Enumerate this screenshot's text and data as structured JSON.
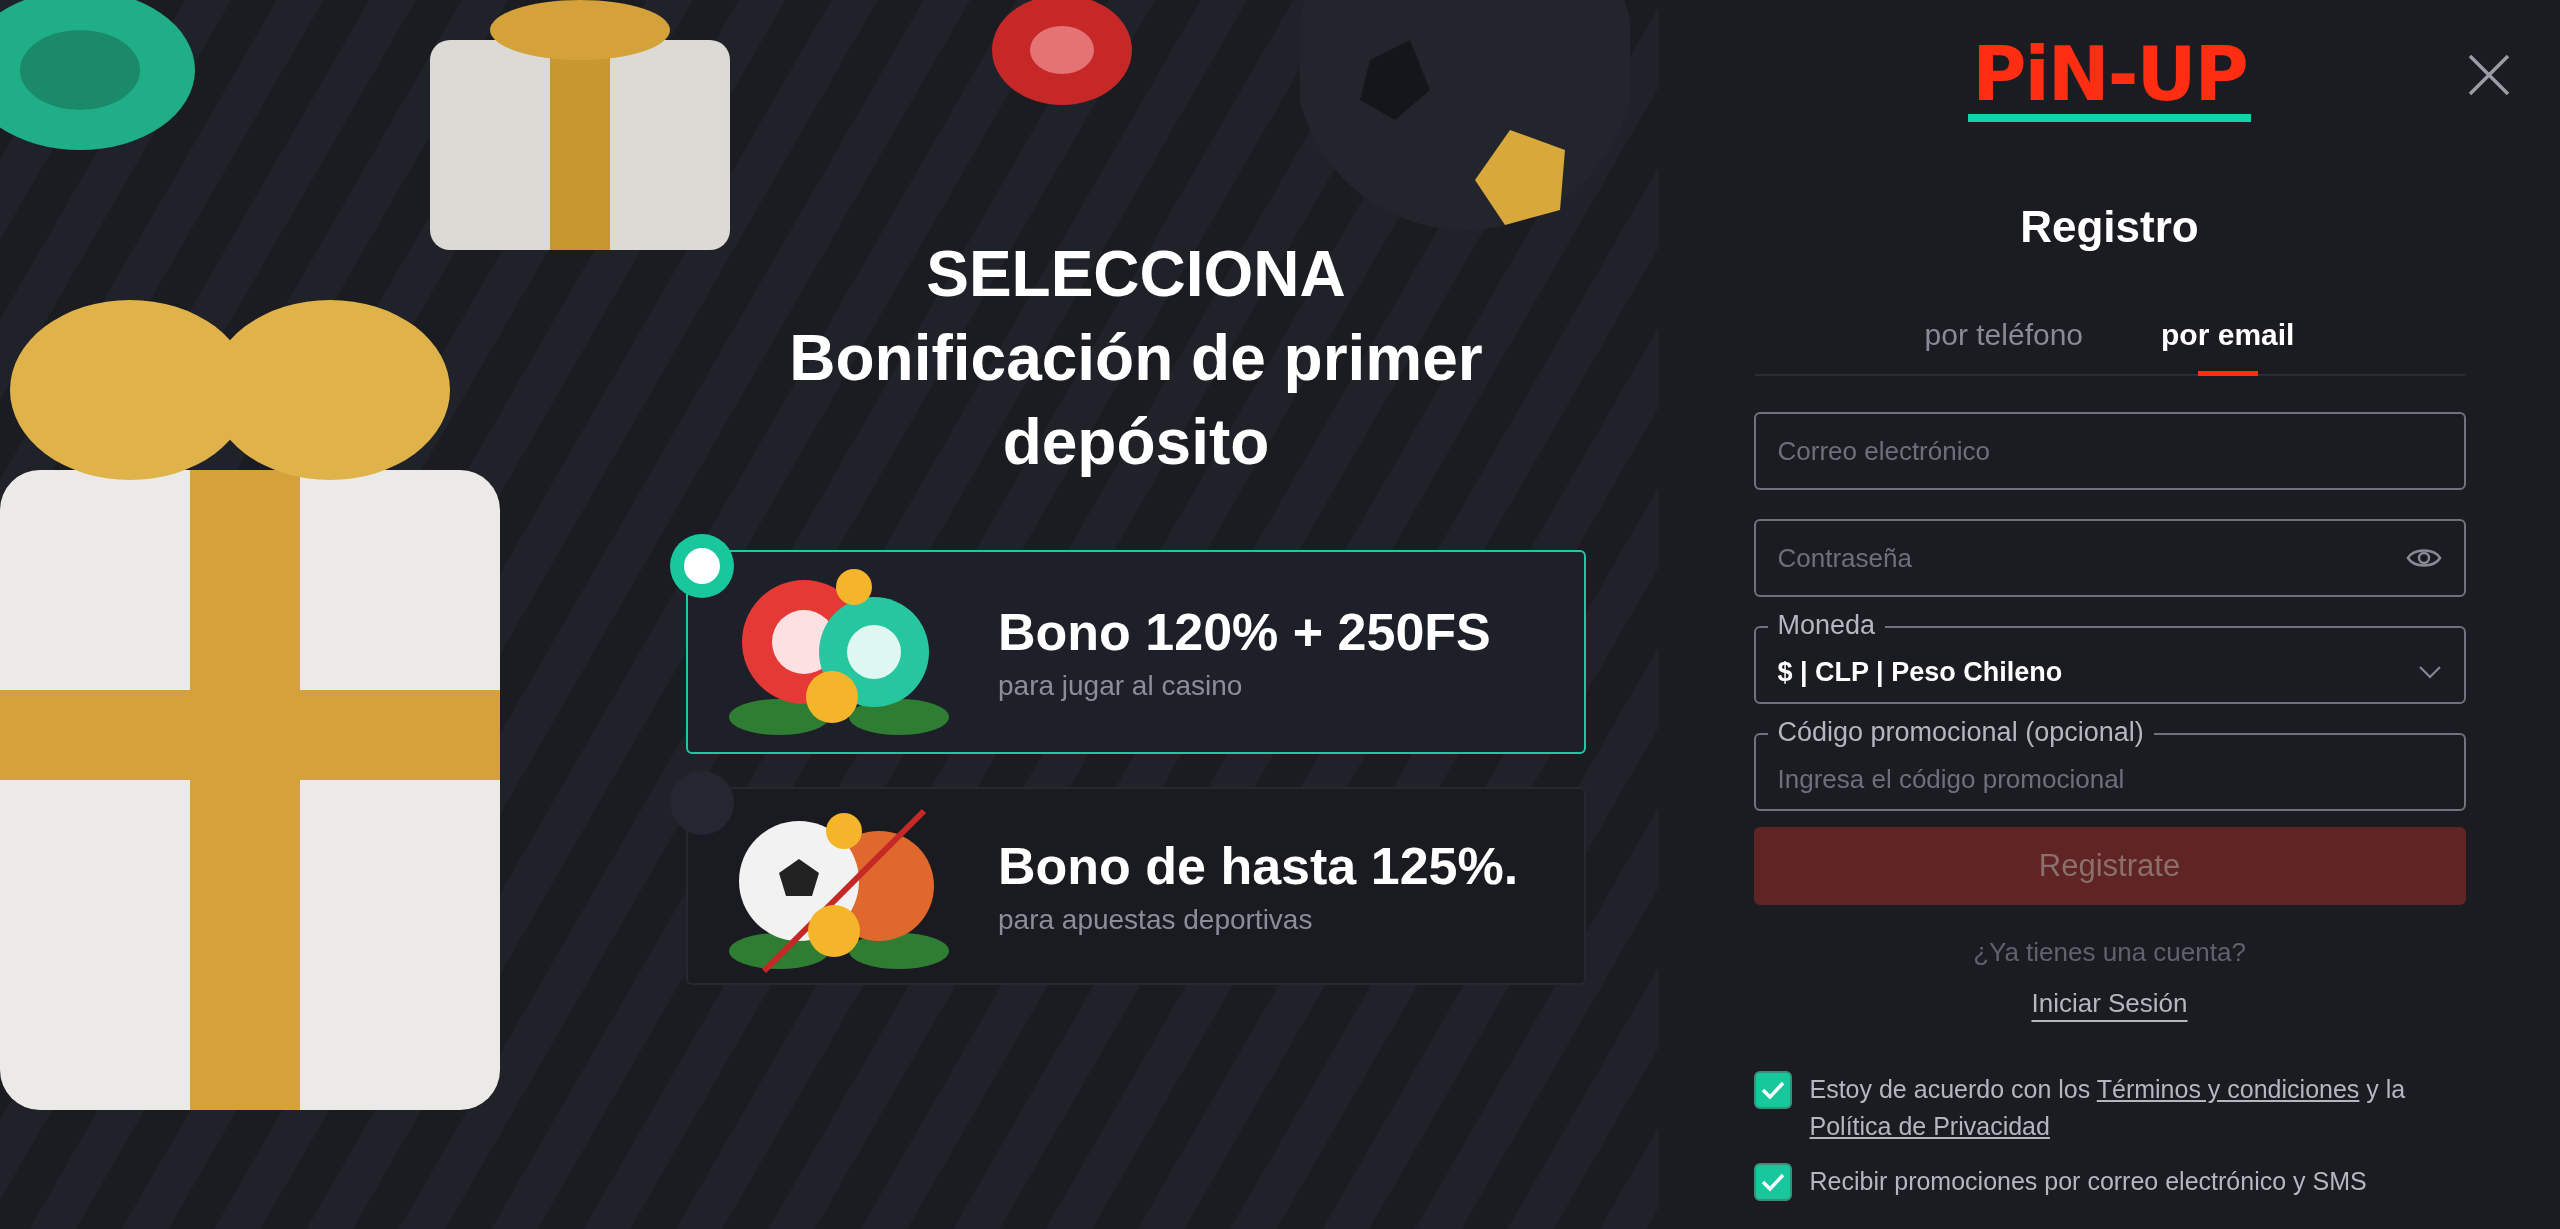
{
  "promo": {
    "heading": "SELECCIONA",
    "subheading": "Bonificación de primer depósito",
    "bonuses": [
      {
        "kind": "casino",
        "title": "Bono 120% + 250FS",
        "subtitle": "para jugar al casino",
        "selected": true
      },
      {
        "kind": "sports",
        "title": "Bono de hasta 125%.",
        "subtitle": "para apuestas deportivas",
        "selected": false
      }
    ]
  },
  "registration": {
    "logo": "PiN-UP",
    "title": "Registro",
    "tabs": [
      {
        "label": "por teléfono",
        "selected": false
      },
      {
        "label": "por email",
        "selected": true
      }
    ],
    "fields": [
      {
        "kind": "email",
        "placeholder": "Correo electrónico"
      },
      {
        "kind": "password",
        "placeholder": "Contraseña"
      },
      {
        "kind": "select",
        "label": "Moneda",
        "value": "$ | CLP | Peso Chileno"
      },
      {
        "kind": "promo",
        "label": "Código promocional (opcional)",
        "placeholder": "Ingresa el código promocional"
      }
    ],
    "submit": {
      "label": "Registrate",
      "disabled": true
    },
    "login_prompt": "¿Ya tienes una cuenta?",
    "login_link": "Iniciar Sesión",
    "consents": [
      {
        "checked": true,
        "parts": [
          {
            "kind": "text",
            "text": "Estoy de acuerdo con los "
          },
          {
            "kind": "link",
            "text": "Términos y condiciones"
          },
          {
            "kind": "text",
            "text": " y la "
          },
          {
            "kind": "link",
            "text": "Política de Privacidad"
          }
        ]
      },
      {
        "checked": true,
        "parts": [
          {
            "kind": "text",
            "text": "Recibir promociones por correo electrónico y SMS"
          }
        ]
      }
    ]
  }
}
